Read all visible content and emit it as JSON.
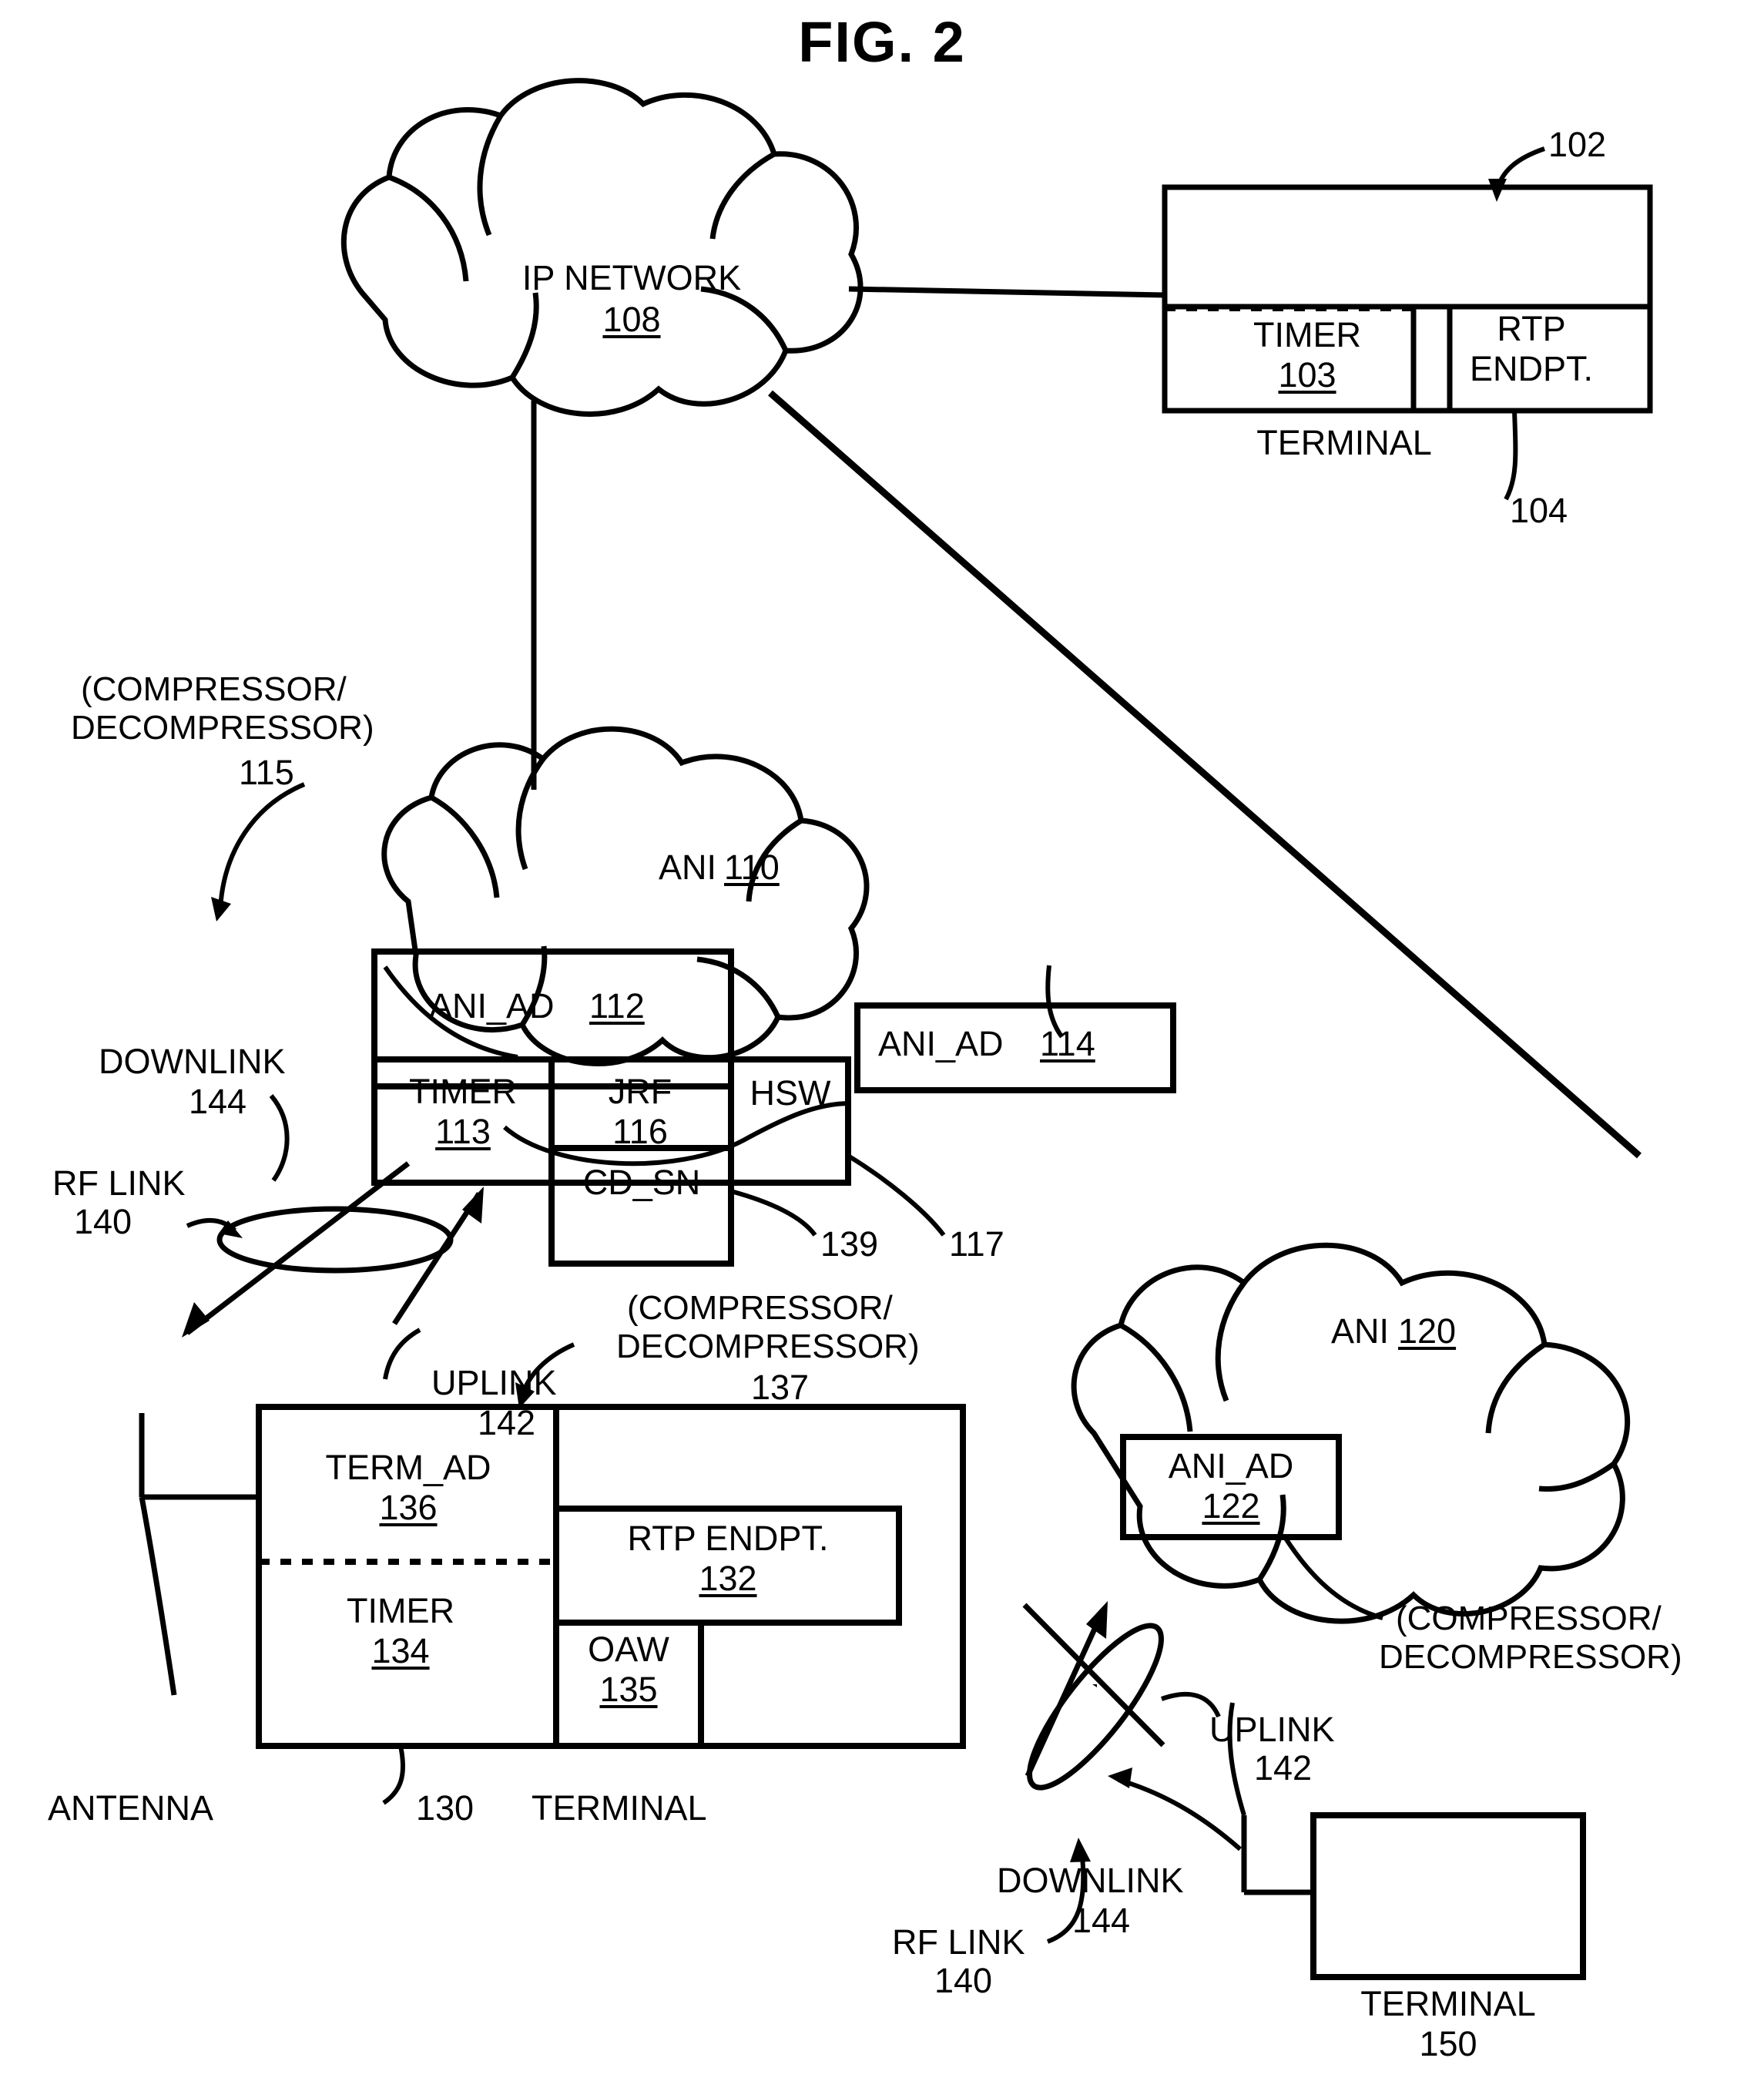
{
  "figure": {
    "title": "FIG. 2"
  },
  "ip_network": {
    "name": "IP NETWORK",
    "ref": "108"
  },
  "terminal_102": {
    "ref": "102",
    "timer_label": "TIMER",
    "timer_ref": "103",
    "rtp_line1": "RTP",
    "rtp_line2": "ENDPT.",
    "caption": "TERMINAL",
    "rtp_ref": "104"
  },
  "ani_110": {
    "name": "ANI",
    "ref": "110",
    "codec_note_line1": "(COMPRESSOR/",
    "codec_note_line2": "DECOMPRESSOR)",
    "codec_ref": "115",
    "ani_ad_112": "ANI_AD",
    "ani_ad_112_ref": "112",
    "timer_label": "TIMER",
    "timer_ref": "113",
    "jrf_label": "JRF",
    "jrf_ref": "116",
    "hsw_label": "HSW",
    "hsw_ref": "117",
    "cd_sn_label": "CD_SN",
    "cd_sn_ref": "139",
    "ani_ad_114": "ANI_AD",
    "ani_ad_114_ref": "114"
  },
  "rf_left": {
    "downlink_label": "DOWNLINK",
    "downlink_ref": "144",
    "rf_link_label": "RF LINK",
    "rf_link_ref": "140",
    "uplink_label": "UPLINK",
    "uplink_ref": "142"
  },
  "terminal_130": {
    "codec_note_line1": "(COMPRESSOR/",
    "codec_note_line2": "DECOMPRESSOR)",
    "codec_ref": "137",
    "term_ad_label": "TERM_AD",
    "term_ad_ref": "136",
    "timer_label": "TIMER",
    "timer_ref": "134",
    "rtp_label": "RTP ENDPT.",
    "rtp_ref": "132",
    "oaw_label": "OAW",
    "oaw_ref": "135",
    "antenna_label": "ANTENNA",
    "ref": "130",
    "caption": "TERMINAL"
  },
  "ani_120": {
    "name": "ANI",
    "ref": "120",
    "ani_ad_122_line1": "ANI_AD",
    "ani_ad_122_line2": "122",
    "codec_note_line1": "(COMPRESSOR/",
    "codec_note_line2": "DECOMPRESSOR)"
  },
  "rf_right": {
    "uplink_label": "UPLINK",
    "uplink_ref": "142",
    "rf_link_label": "RF LINK",
    "rf_link_ref": "140",
    "downlink_label": "DOWNLINK",
    "downlink_ref": "144"
  },
  "terminal_150": {
    "caption": "TERMINAL",
    "ref": "150"
  }
}
